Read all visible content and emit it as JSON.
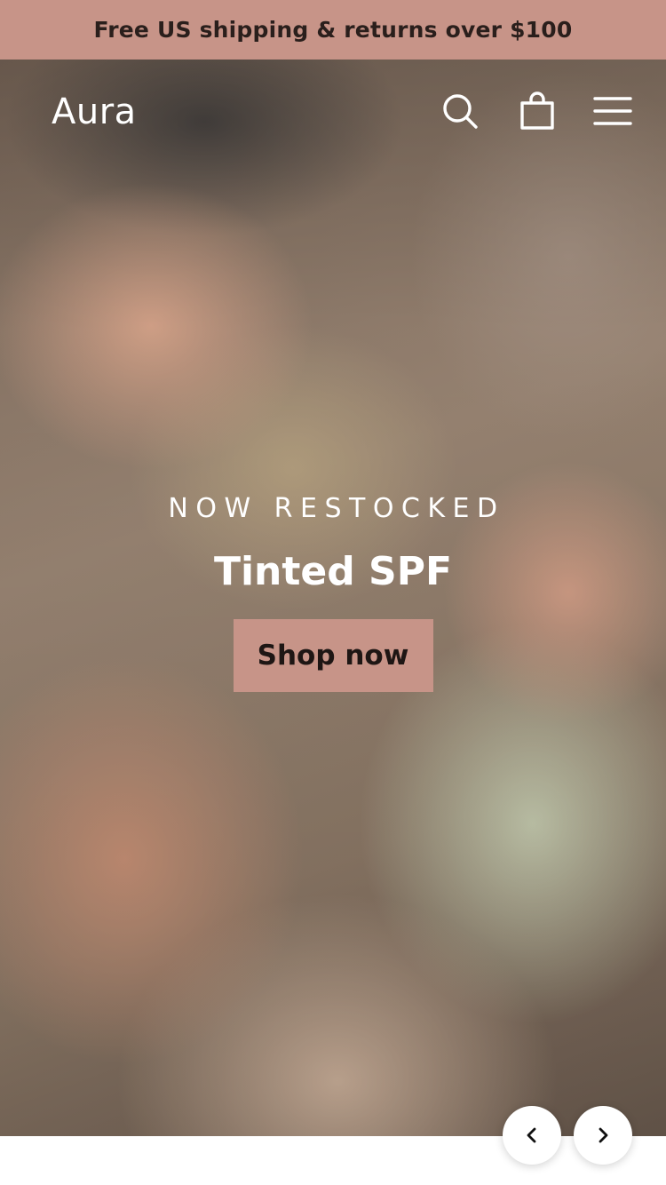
{
  "announcement": {
    "text": "Free US shipping & returns over $100"
  },
  "header": {
    "logo": "Aura",
    "icons": {
      "search": "search-icon",
      "cart": "bag-icon",
      "menu": "hamburger-menu-icon"
    }
  },
  "hero": {
    "eyebrow": "NOW RESTOCKED",
    "headline": "Tinted SPF",
    "cta_label": "Shop now",
    "image_alt": "three people lying down"
  },
  "slider": {
    "prev_icon": "chevron-left-icon",
    "next_icon": "chevron-right-icon"
  },
  "colors": {
    "accent": "#c79488",
    "text_dark": "#2a1f1c",
    "white": "#ffffff"
  }
}
